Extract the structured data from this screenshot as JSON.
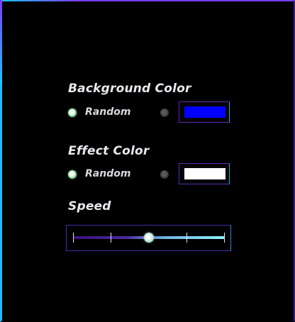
{
  "background_color": {
    "label": "Background Color",
    "random_label": "Random",
    "random_selected": true,
    "custom_selected": false,
    "swatch_color": "#0000ff"
  },
  "effect_color": {
    "label": "Effect Color",
    "random_label": "Random",
    "random_selected": true,
    "custom_selected": false,
    "swatch_color": "#ffffff"
  },
  "speed": {
    "label": "Speed",
    "ticks": 5,
    "value_fraction": 0.5
  },
  "colors": {
    "accent_purple": "#7a3cff",
    "accent_cyan": "#1fb8ff"
  }
}
